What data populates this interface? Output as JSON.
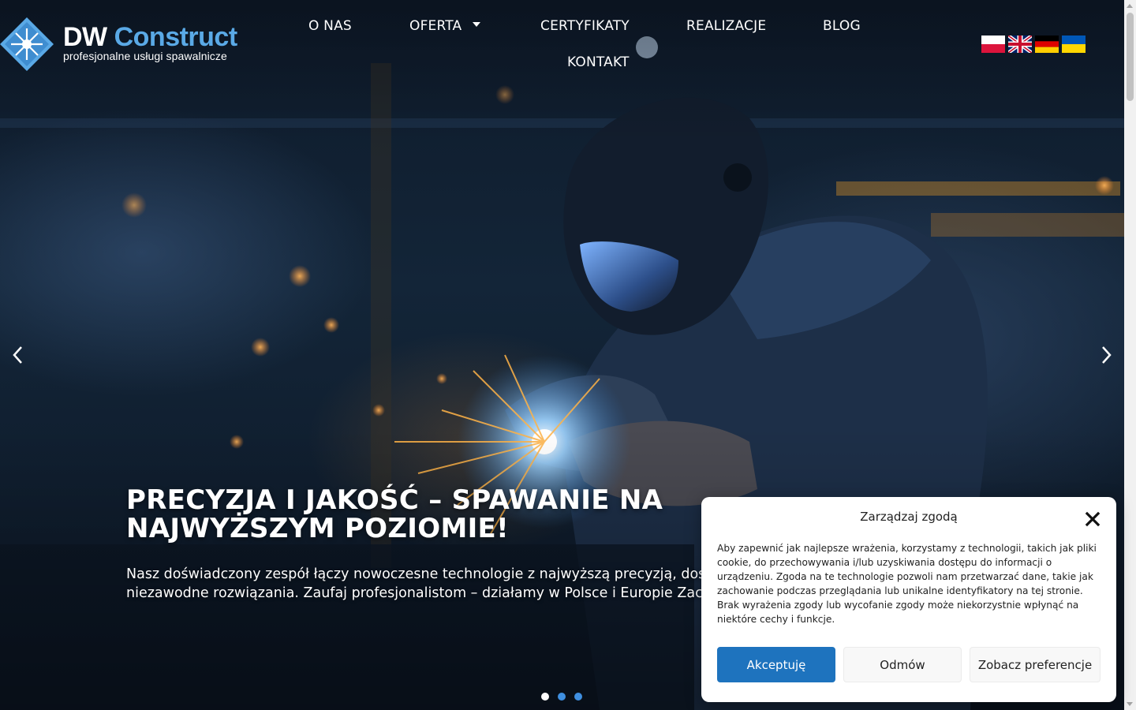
{
  "brand": {
    "name_part1": "DW",
    "name_part2": "Construct",
    "tagline": "profesjonalne usługi spawalnicze",
    "accent_color": "#5aa9e6"
  },
  "nav": {
    "items": [
      {
        "label": "O NAS"
      },
      {
        "label": "OFERTA",
        "has_dropdown": true
      },
      {
        "label": "CERTYFIKATY"
      },
      {
        "label": "REALIZACJE"
      },
      {
        "label": "BLOG"
      },
      {
        "label": "KONTAKT"
      }
    ]
  },
  "languages": [
    {
      "code": "pl",
      "icon": "flag-poland-icon"
    },
    {
      "code": "en",
      "icon": "flag-uk-icon"
    },
    {
      "code": "de",
      "icon": "flag-germany-icon"
    },
    {
      "code": "uk",
      "icon": "flag-ukraine-icon"
    }
  ],
  "hero": {
    "title": "PRECYZJA I JAKOŚĆ – SPAWANIE NA NAJWYŻSZYM POZIOMIE!",
    "description": "Nasz doświadczony zespół łączy nowoczesne technologie z najwyższą precyzją, dostarczając trwałe i niezawodne rozwiązania. Zaufaj profesjonalistom – działamy w Polsce i Europie Zachodniej!",
    "slides_count": 3,
    "active_slide": 1
  },
  "consent": {
    "title": "Zarządzaj zgodą",
    "text": "Aby zapewnić jak najlepsze wrażenia, korzystamy z technologii, takich jak pliki cookie, do przechowywania i/lub uzyskiwania dostępu do informacji o urządzeniu. Zgoda na te technologie pozwoli nam przetwarzać dane, takie jak zachowanie podczas przeglądania lub unikalne identyfikatory na tej stronie. Brak wyrażenia zgody lub wycofanie zgody może niekorzystnie wpłynąć na niektóre cechy i funkcje.",
    "accept_label": "Akceptuję",
    "deny_label": "Odmów",
    "preferences_label": "Zobacz preferencje",
    "accept_color": "#1e73be"
  }
}
